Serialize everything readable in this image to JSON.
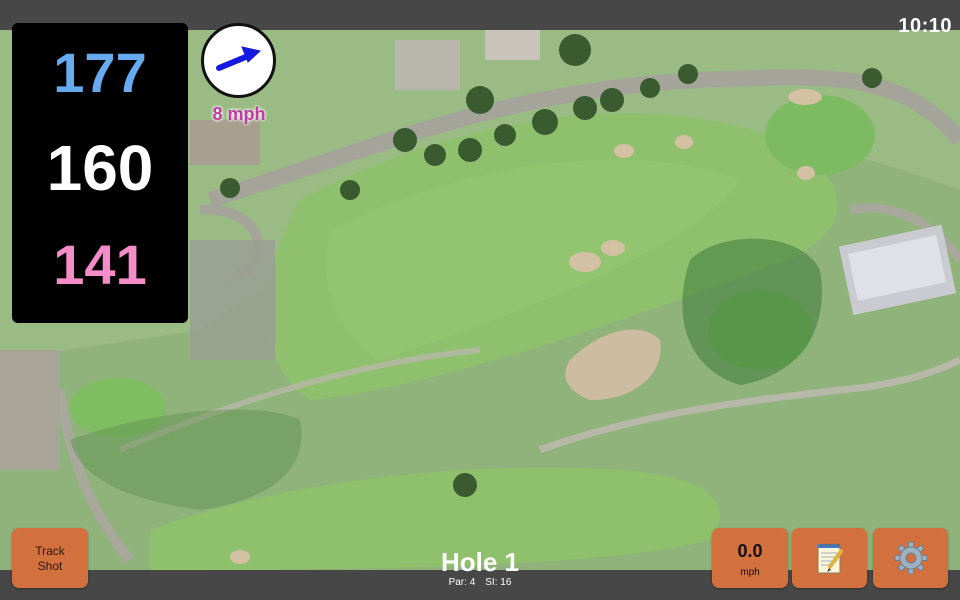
{
  "status": {
    "time": "10:10"
  },
  "distances": {
    "back": "177",
    "middle": "160",
    "front": "141",
    "colors": {
      "back": "#66aaf0",
      "middle": "#ffffff",
      "front": "#f48cc8"
    }
  },
  "wind": {
    "speed": "8 mph",
    "speed_color": "#c23aa8",
    "arrow_color": "#1418e0",
    "direction": "east-northeast",
    "icon": "wind-arrow-icon"
  },
  "buttons": {
    "track_shot_line1": "Track",
    "track_shot_line2": "Shot",
    "speed_value": "0.0",
    "speed_unit": "mph",
    "notes_icon": "notepad-icon",
    "settings_icon": "gear-icon",
    "color": "#d2703e"
  },
  "hole": {
    "title": "Hole 1",
    "par": "Par: 4",
    "stroke_index": "SI: 16"
  },
  "map": {
    "type": "satellite",
    "fairway_color": "#8fc06e",
    "rough_color": "#6f9a58"
  }
}
